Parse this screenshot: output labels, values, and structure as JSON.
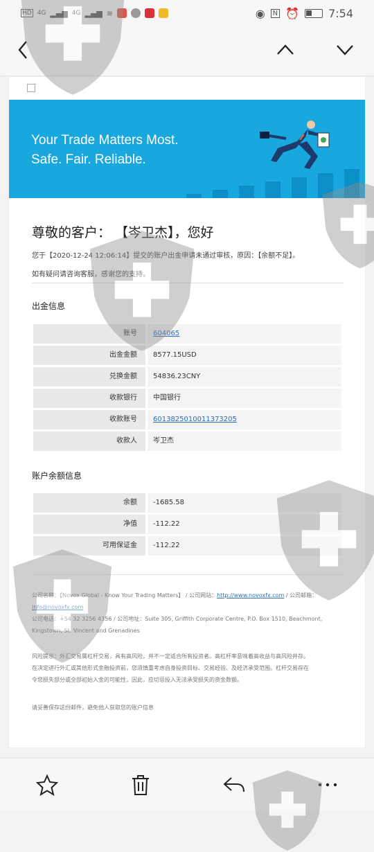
{
  "statusbar": {
    "sim1": "HD",
    "sim2": "HD",
    "net1": "4G",
    "net2": "4G",
    "time": "7:54"
  },
  "banner": {
    "line1": "Your Trade Matters Most.",
    "line2": "Safe. Fair. Reliable."
  },
  "greeting": "尊敬的客户： 【岑卫杰】，您好",
  "notice": "您于【2020-12-24 12:06:14】提交的账户出金申请未通过审核，原因：【余额不足】。",
  "notice2": "如有疑问请咨询客服，感谢您的支持。",
  "withdrawal": {
    "title": "出金信息",
    "rows": [
      {
        "label": "账号",
        "value": "604065",
        "link": true
      },
      {
        "label": "出金金额",
        "value": "8577.15USD",
        "link": false
      },
      {
        "label": "兑换金额",
        "value": "54836.23CNY",
        "link": false
      },
      {
        "label": "收款银行",
        "value": "中国银行",
        "link": false
      },
      {
        "label": "收款账号",
        "value": "6013825010011373205",
        "link": true
      },
      {
        "label": "收款人",
        "value": "岑卫杰",
        "link": false
      }
    ]
  },
  "balance": {
    "title": "账户余额信息",
    "rows": [
      {
        "label": "余额",
        "value": "-1685.58"
      },
      {
        "label": "净值",
        "value": "-112.22"
      },
      {
        "label": "可用保证金",
        "value": "-112.22"
      }
    ]
  },
  "footer": {
    "company_label": "公司名称：",
    "company_name": "【Novox Global - Know Your Trading Matters】",
    "website_label": "/ 公司网站：",
    "website": "http://www.novoxfx.com",
    "email_label": "/ 公司邮箱：",
    "email": "info@novoxfx.com",
    "phone": "公司电话：+54 32 3256 4356",
    "address": "/ 公司地址：Suite 305, Griffith Corporate Centre, P.O. Box 1510, Beachmont,",
    "address2": "Kingstown, St. Vincent and Grenadines",
    "risk1": "风险提示：外汇交易属杠杆交易，具有高风险，并不一定适合所有投资者。高杠杆率意味着高收益与高风险并存。",
    "risk2": "在决定进行外汇或其他形式金融投资前，您须慎重考虑自身投资目标、交易经验、及经济承受范围。杠杆交易存在",
    "risk3": "令您损失部分或全部初始入金的可能性，因此，应切忌投入无法承受损失的资金数额。",
    "keep": "请妥善保存这份邮件，避免他人获取您的账户信息"
  },
  "colors": {
    "banner": "#19a8dd",
    "link": "#2a6fb6",
    "watermark": "#9a9a9a"
  },
  "icons": [
    "back-icon",
    "chevron-up-icon",
    "chevron-down-icon",
    "star-icon",
    "trash-icon",
    "reply-icon",
    "more-icon"
  ]
}
